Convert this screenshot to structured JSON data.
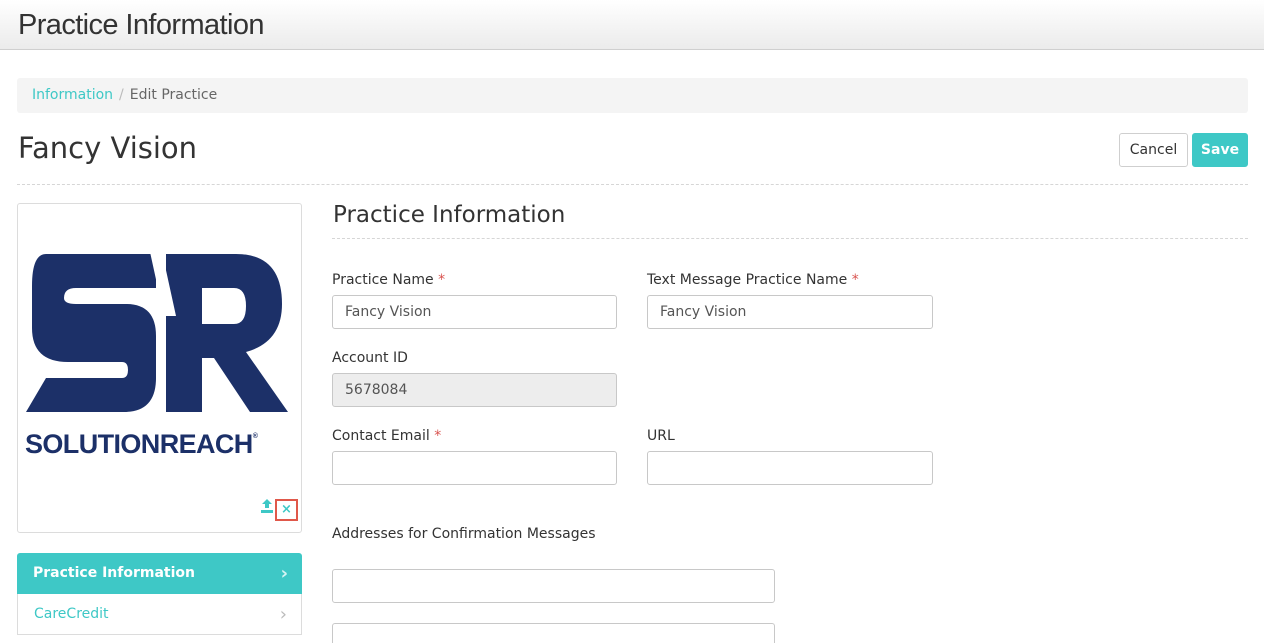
{
  "header": {
    "title": "Practice Information"
  },
  "breadcrumb": {
    "link": "Information",
    "separator": "/",
    "current": "Edit Practice"
  },
  "page": {
    "title": "Fancy Vision"
  },
  "actions": {
    "cancel_label": "Cancel",
    "save_label": "Save"
  },
  "logo": {
    "wordmark": "SOLUTIONREACH",
    "trademark": "®",
    "remove_glyph": "×"
  },
  "sidebar": {
    "items": [
      {
        "label": "Practice Information",
        "active": true
      },
      {
        "label": "CareCredit",
        "active": false
      }
    ],
    "chevron": "›"
  },
  "form": {
    "section_title": "Practice Information",
    "required_mark": "*",
    "practice_name": {
      "label": "Practice Name",
      "value": "Fancy Vision"
    },
    "text_message_name": {
      "label": "Text Message Practice Name",
      "value": "Fancy Vision"
    },
    "account_id": {
      "label": "Account ID",
      "value": "5678084"
    },
    "contact_email": {
      "label": "Contact Email",
      "value": ""
    },
    "url": {
      "label": "URL",
      "value": ""
    },
    "confirmation_addresses": {
      "label": "Addresses for Confirmation Messages",
      "values": [
        "",
        ""
      ]
    }
  },
  "colors": {
    "accent": "#3ec8c6",
    "logo_navy": "#1c3068",
    "required": "#d9534f",
    "highlight": "#e0584a"
  },
  "icons": {
    "upload": "upload-icon",
    "remove": "close-icon",
    "chevron": "chevron-right-icon"
  }
}
